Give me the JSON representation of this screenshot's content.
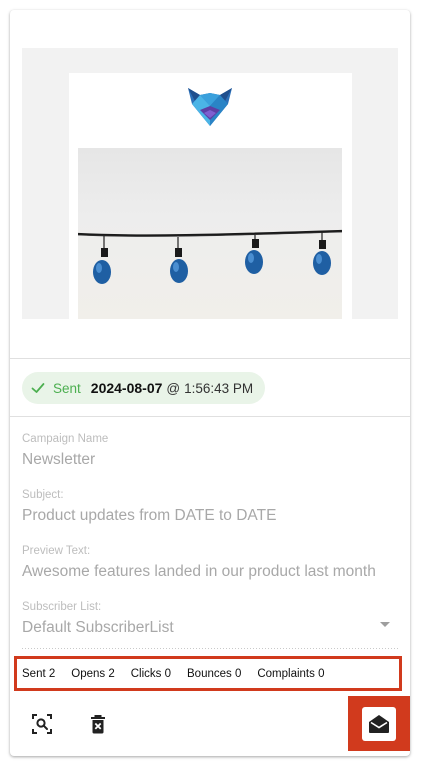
{
  "status": {
    "label": "Sent",
    "date": "2024-08-07",
    "at": "@",
    "time": "1:56:43 PM"
  },
  "fields": {
    "campaign_name": {
      "label": "Campaign Name",
      "value": "Newsletter"
    },
    "subject": {
      "label": "Subject:",
      "value": "Product updates from DATE to DATE"
    },
    "preview_text": {
      "label": "Preview Text:",
      "value": "Awesome features landed in our product last month"
    },
    "subscriber_list": {
      "label": "Subscriber List:",
      "value": "Default SubscriberList"
    }
  },
  "stats": {
    "sent": "Sent 2",
    "opens": "Opens 2",
    "clicks": "Clicks 0",
    "bounces": "Bounces 0",
    "complaints": "Complaints 0"
  },
  "icons": {
    "status": "check-icon",
    "preview": "image-search-icon",
    "delete": "delete-icon",
    "send": "drafts-envelope-icon",
    "dropdown": "chevron-down-icon"
  },
  "colors": {
    "highlight": "#d13a1d",
    "status_chip_bg": "#e9f4e8",
    "status_green": "#4caf50"
  }
}
